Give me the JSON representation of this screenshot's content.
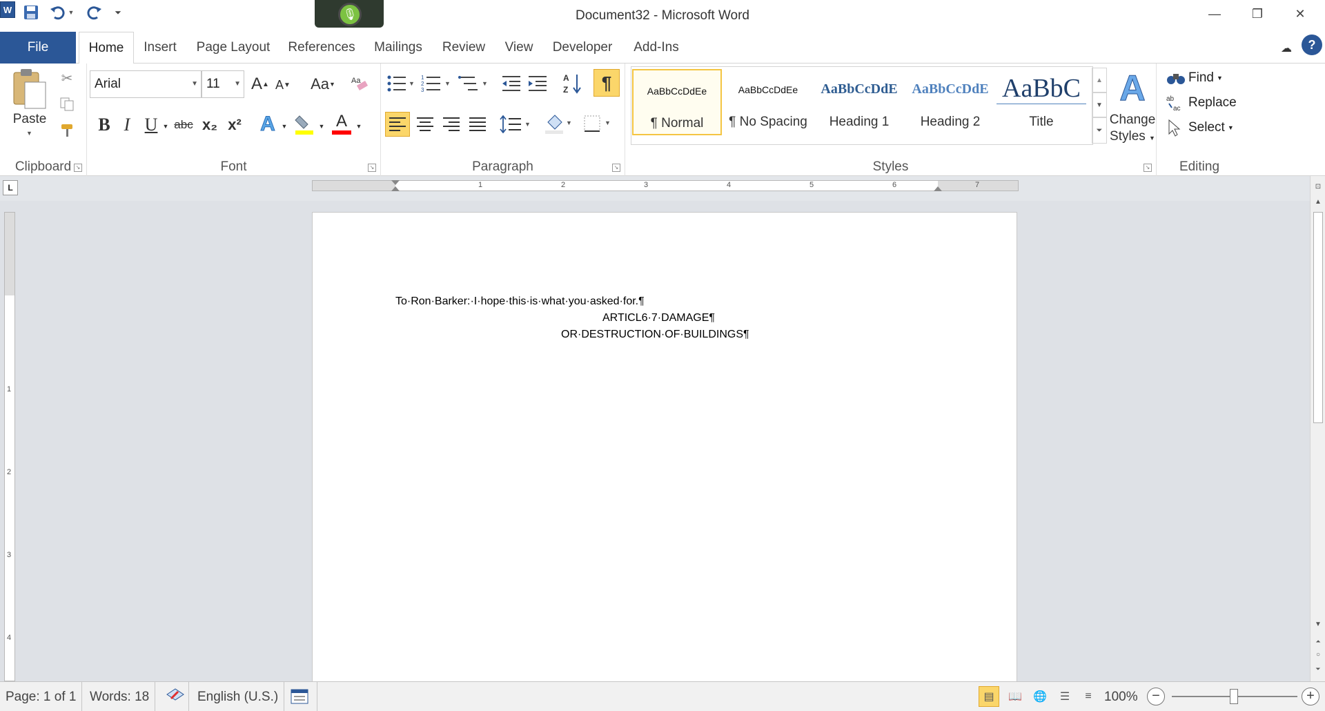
{
  "app": {
    "title": "Document32 - Microsoft Word",
    "logo_letter": "W"
  },
  "window_controls": {
    "minimize": "—",
    "restore": "❐",
    "close": "✕"
  },
  "tabs": [
    {
      "label": "File"
    },
    {
      "label": "Home"
    },
    {
      "label": "Insert"
    },
    {
      "label": "Page Layout"
    },
    {
      "label": "References"
    },
    {
      "label": "Mailings"
    },
    {
      "label": "Review"
    },
    {
      "label": "View"
    },
    {
      "label": "Developer"
    },
    {
      "label": "Add-Ins"
    }
  ],
  "ribbon": {
    "clipboard": {
      "label": "Clipboard",
      "paste": "Paste"
    },
    "font": {
      "label": "Font",
      "font_name": "Arial",
      "font_size": "11",
      "bold": "B",
      "italic": "I",
      "underline": "U",
      "strike": "abc",
      "subscript": "x₂",
      "superscript": "x²",
      "grow": "A",
      "shrink": "A",
      "change_case": "Aa",
      "text_effects": "A",
      "font_color": "A",
      "highlight_color": "#ffff00",
      "font_color_value": "#ff0000"
    },
    "paragraph": {
      "label": "Paragraph",
      "show_marks": "¶"
    },
    "styles": {
      "label": "Styles",
      "items": [
        {
          "preview": "AaBbCcDdEe",
          "name": "¶ Normal"
        },
        {
          "preview": "AaBbCcDdEe",
          "name": "¶ No Spacing"
        },
        {
          "preview": "AaBbCcDdE",
          "name": "Heading 1"
        },
        {
          "preview": "AaBbCcDdE",
          "name": "Heading 2"
        },
        {
          "preview": "AaBbC",
          "name": "Title"
        }
      ],
      "change_styles": "Change Styles"
    },
    "editing": {
      "label": "Editing",
      "find": "Find",
      "replace": "Replace",
      "select": "Select"
    }
  },
  "ruler": {
    "numbers": [
      "1",
      "2",
      "3",
      "4",
      "5",
      "6",
      "7"
    ],
    "vertical_numbers": [
      "1",
      "2",
      "3",
      "4"
    ]
  },
  "document": {
    "lines": [
      "To·Ron·Barker:·I·hope·this·is·what·you·asked·for.¶",
      "ARTICL6·7·DAMAGE¶",
      "OR·DESTRUCTION·OF·BUILDINGS¶"
    ]
  },
  "status": {
    "page": "Page: 1 of 1",
    "words": "Words: 18",
    "language": "English (U.S.)",
    "zoom": "100%"
  }
}
